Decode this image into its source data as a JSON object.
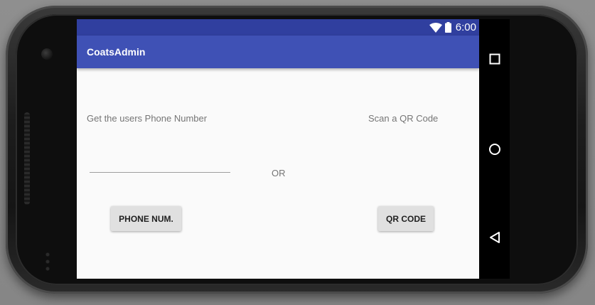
{
  "status_bar": {
    "time": "6:00",
    "icons": [
      "wifi-icon",
      "battery-icon"
    ],
    "color": "#303f9f"
  },
  "app_bar": {
    "title": "CoatsAdmin",
    "color": "#3f51b5"
  },
  "main": {
    "phone_label": "Get the users Phone Number",
    "qr_label": "Scan a QR Code",
    "or_label": "OR",
    "phone_input": {
      "value": "",
      "placeholder": ""
    },
    "phone_button_label": "PHONE NUM.",
    "qr_button_label": "QR CODE"
  },
  "nav_bar": {
    "icons": [
      "recents-icon",
      "home-icon",
      "back-icon"
    ]
  },
  "colors": {
    "background": "#fafafa",
    "text_secondary": "#757575",
    "button": "#e0e0e0"
  }
}
